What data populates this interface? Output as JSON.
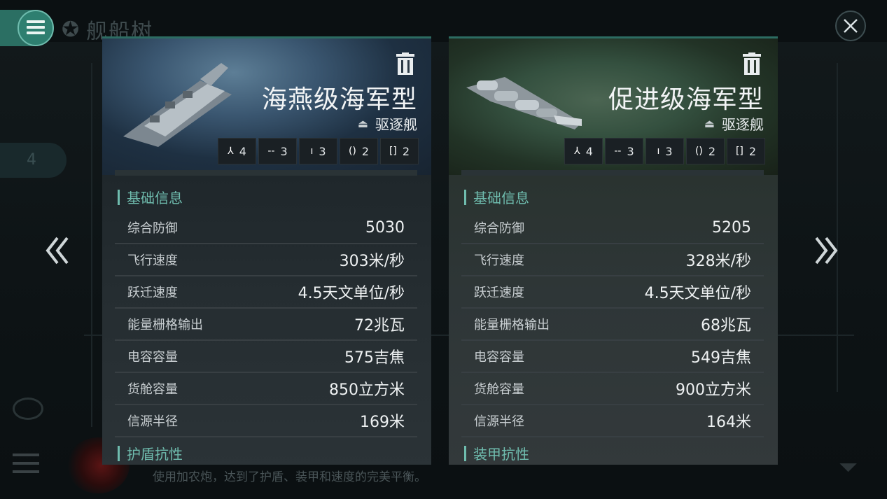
{
  "background": {
    "title": "舰船树",
    "badge_number": "4",
    "description": "使用加农炮，达到了护盾、装甲和速度的完美平衡。"
  },
  "ships": [
    {
      "name": "海燕级海军型",
      "class": "驱逐舰",
      "slots": [
        {
          "icon": "high-slot-icon",
          "glyph": "⅄",
          "count": "4"
        },
        {
          "icon": "mid-slot-icon",
          "glyph": "--",
          "count": "3"
        },
        {
          "icon": "low-slot-icon",
          "glyph": "ı",
          "count": "3"
        },
        {
          "icon": "rig-slot-icon",
          "glyph": "()",
          "count": "2"
        },
        {
          "icon": "subsystem-slot-icon",
          "glyph": "[]",
          "count": "2"
        }
      ],
      "section_basic": "基础信息",
      "stats": [
        {
          "label": "综合防御",
          "value": "5030"
        },
        {
          "label": "飞行速度",
          "value": "303米/秒"
        },
        {
          "label": "跃迁速度",
          "value": "4.5天文单位/秒"
        },
        {
          "label": "能量栅格输出",
          "value": "72兆瓦"
        },
        {
          "label": "电容容量",
          "value": "575吉焦"
        },
        {
          "label": "货舱容量",
          "value": "850立方米"
        },
        {
          "label": "信源半径",
          "value": "169米"
        }
      ],
      "section_next": "护盾抗性"
    },
    {
      "name": "促进级海军型",
      "class": "驱逐舰",
      "slots": [
        {
          "icon": "high-slot-icon",
          "glyph": "⅄",
          "count": "4"
        },
        {
          "icon": "mid-slot-icon",
          "glyph": "--",
          "count": "3"
        },
        {
          "icon": "low-slot-icon",
          "glyph": "ı",
          "count": "3"
        },
        {
          "icon": "rig-slot-icon",
          "glyph": "()",
          "count": "2"
        },
        {
          "icon": "subsystem-slot-icon",
          "glyph": "[]",
          "count": "2"
        }
      ],
      "section_basic": "基础信息",
      "stats": [
        {
          "label": "综合防御",
          "value": "5205"
        },
        {
          "label": "飞行速度",
          "value": "328米/秒"
        },
        {
          "label": "跃迁速度",
          "value": "4.5天文单位/秒"
        },
        {
          "label": "能量栅格输出",
          "value": "68兆瓦"
        },
        {
          "label": "电容容量",
          "value": "549吉焦"
        },
        {
          "label": "货舱容量",
          "value": "900立方米"
        },
        {
          "label": "信源半径",
          "value": "164米"
        }
      ],
      "section_next": "装甲抗性"
    }
  ],
  "colors": {
    "accent": "#6fbcae",
    "menu_button": "#2b6f63"
  }
}
